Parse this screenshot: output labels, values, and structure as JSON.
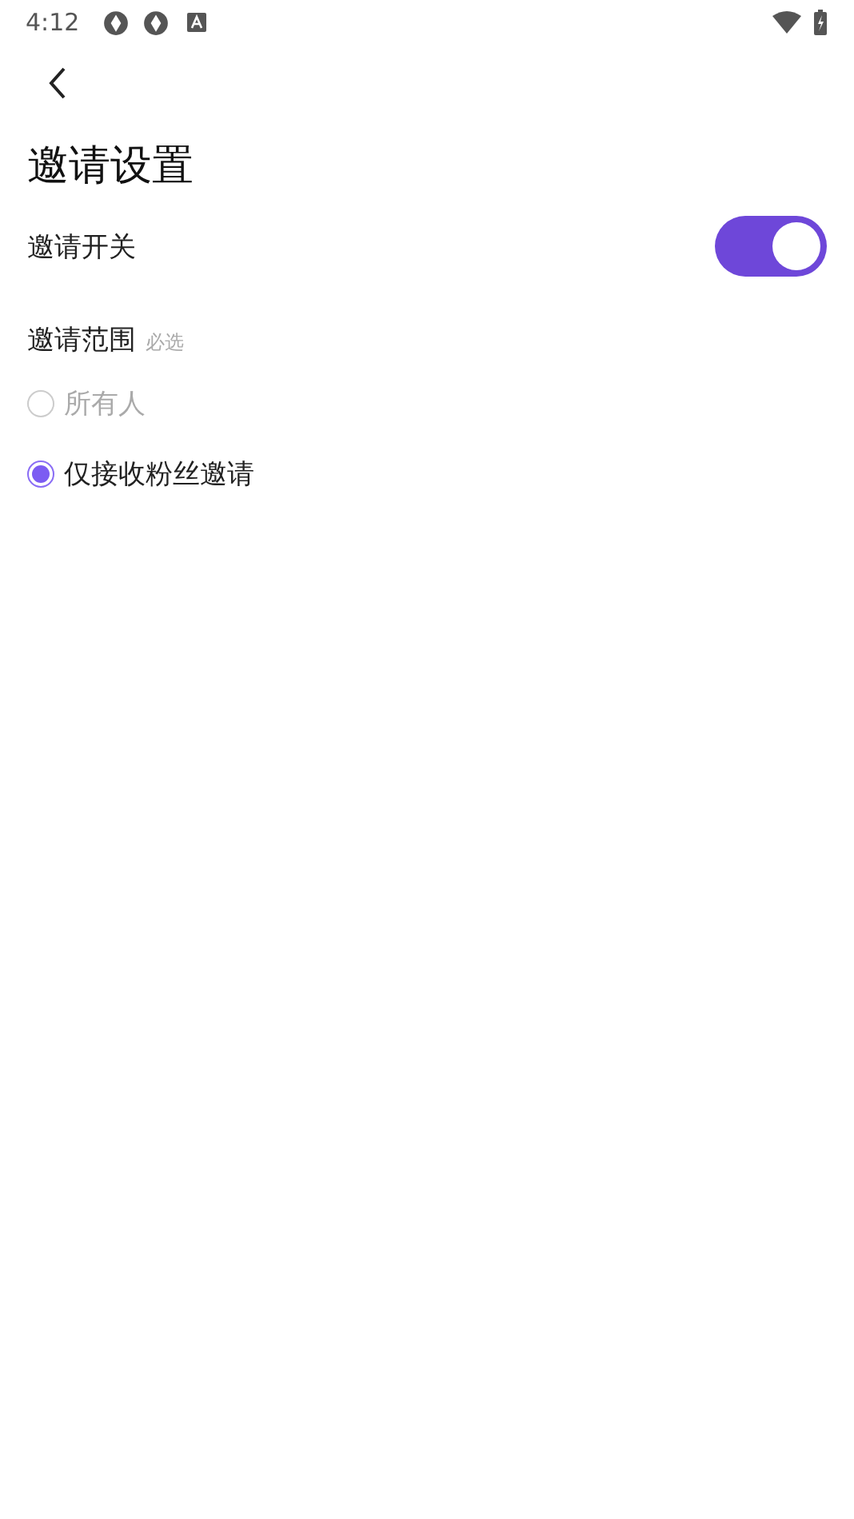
{
  "status_bar": {
    "time": "4:12"
  },
  "page": {
    "title": "邀请设置"
  },
  "switch_row": {
    "label": "邀请开关",
    "on": true
  },
  "range": {
    "label": "邀请范围",
    "hint": "必选",
    "options": [
      {
        "label": "所有人",
        "selected": false,
        "disabled": true
      },
      {
        "label": "仅接收粉丝邀请",
        "selected": true,
        "disabled": false
      }
    ]
  }
}
